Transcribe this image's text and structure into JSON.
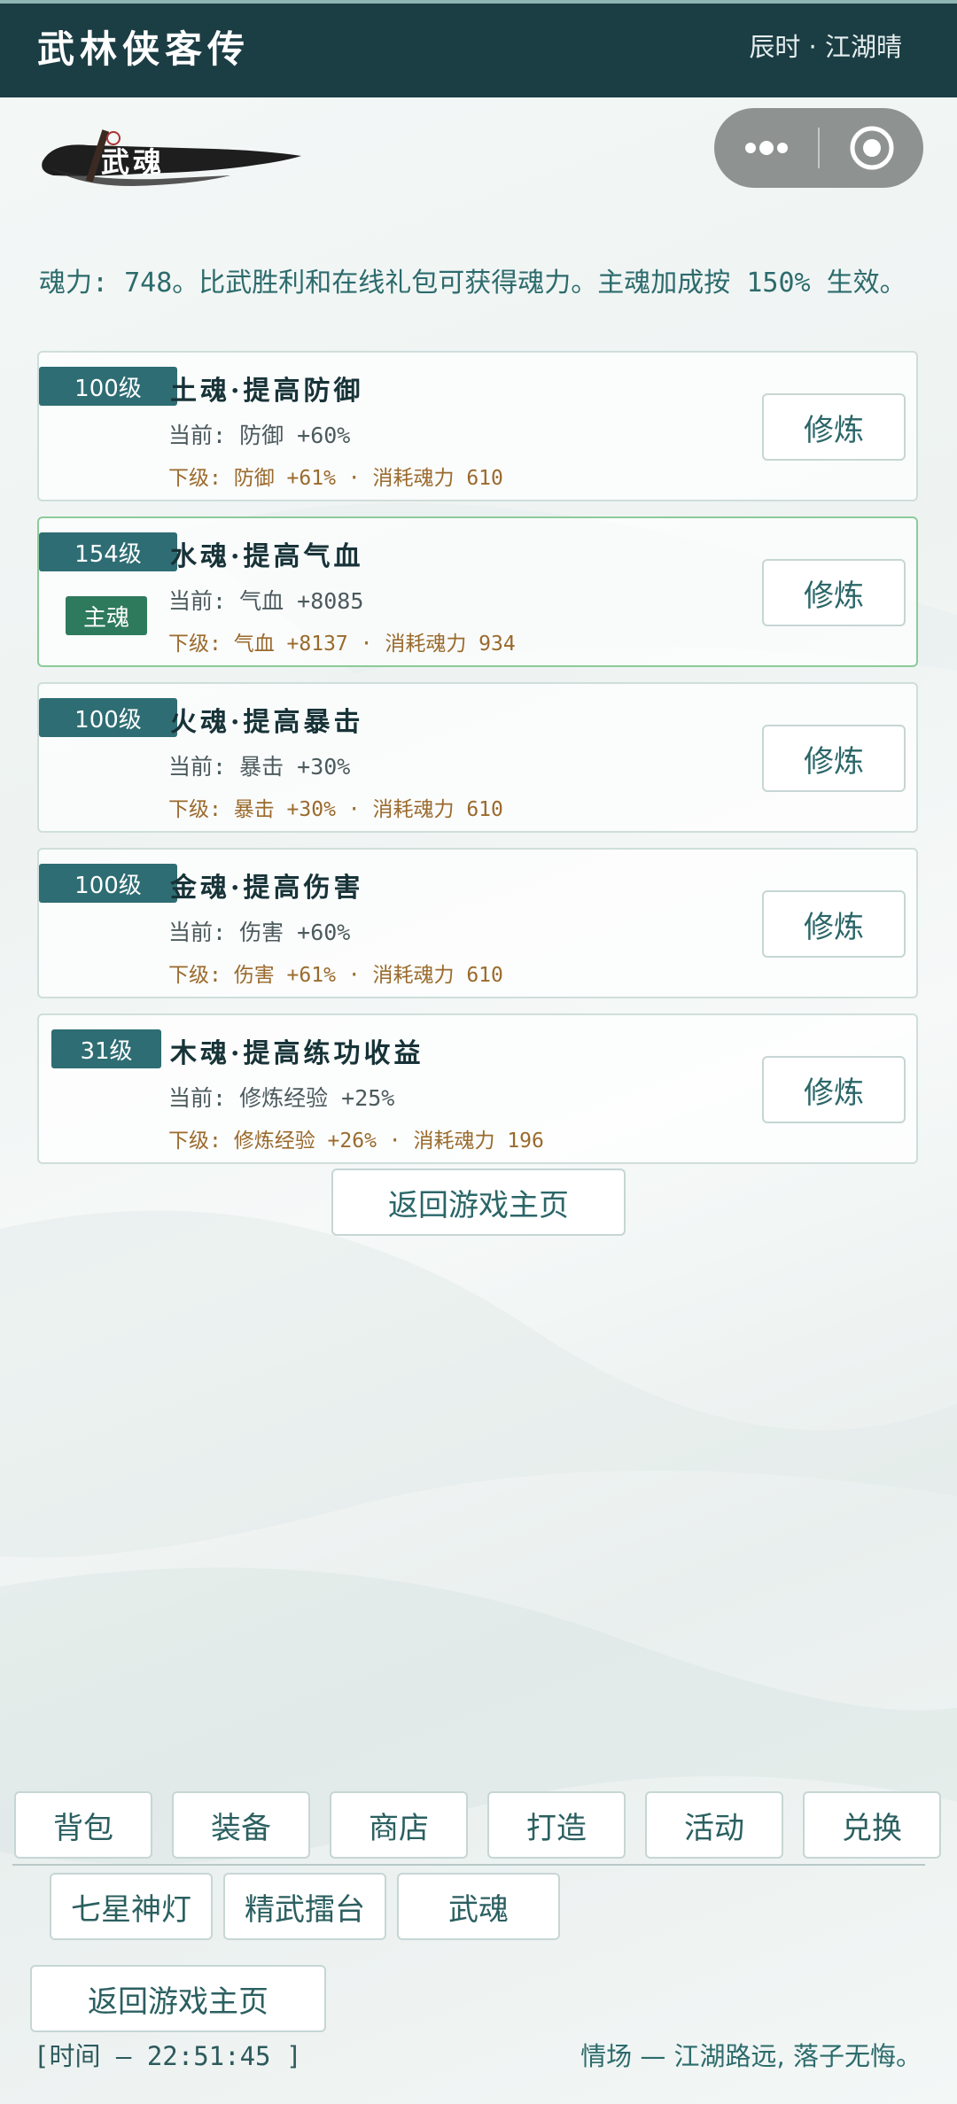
{
  "header": {
    "app_title": "武林侠客传",
    "time_weather": "辰时 · 江湖晴"
  },
  "section": {
    "title": "武魂"
  },
  "info": {
    "text": "魂力: 748。比武胜利和在线礼包可获得魂力。主魂加成按 150% 生效。"
  },
  "souls": [
    {
      "level": "100级",
      "name": "土魂·提高防御",
      "current": "当前: 防御 +60%",
      "next": "下级: 防御 +61% · 消耗魂力 610",
      "primary": false,
      "button": "修炼"
    },
    {
      "level": "154级",
      "name": "水魂·提高气血",
      "current": "当前: 气血 +8085",
      "next": "下级: 气血 +8137 · 消耗魂力 934",
      "primary": true,
      "primary_label": "主魂",
      "button": "修炼"
    },
    {
      "level": "100级",
      "name": "火魂·提高暴击",
      "current": "当前: 暴击 +30%",
      "next": "下级: 暴击 +30% · 消耗魂力 610",
      "primary": false,
      "button": "修炼"
    },
    {
      "level": "100级",
      "name": "金魂·提高伤害",
      "current": "当前: 伤害 +60%",
      "next": "下级: 伤害 +61% · 消耗魂力 610",
      "primary": false,
      "button": "修炼"
    },
    {
      "level": "31级",
      "name": "木魂·提高练功收益",
      "current": "当前: 修炼经验 +25%",
      "next": "下级: 修炼经验 +26% · 消耗魂力 196",
      "primary": false,
      "button": "修炼"
    }
  ],
  "main": {
    "return_label": "返回游戏主页"
  },
  "nav": {
    "row1": [
      "背包",
      "装备",
      "商店",
      "打造",
      "活动",
      "兑换"
    ],
    "row2": [
      "七星神灯",
      "精武擂台",
      "武魂"
    ],
    "return_label": "返回游戏主页"
  },
  "footer": {
    "time": "[时间 — 22:51:45 ]",
    "quote": "情场 — 江湖路远, 落子无悔。"
  },
  "colors": {
    "header_bg": "#1b3d44",
    "level_tag": "#2e6d73",
    "primary_tag": "#2e7a5c",
    "next_level_text": "#9a6a2c",
    "accent_text": "#2d6b6c"
  },
  "icons": {
    "more": "more-dots-icon",
    "close": "target-close-icon",
    "banner": "ink-brush-icon"
  }
}
